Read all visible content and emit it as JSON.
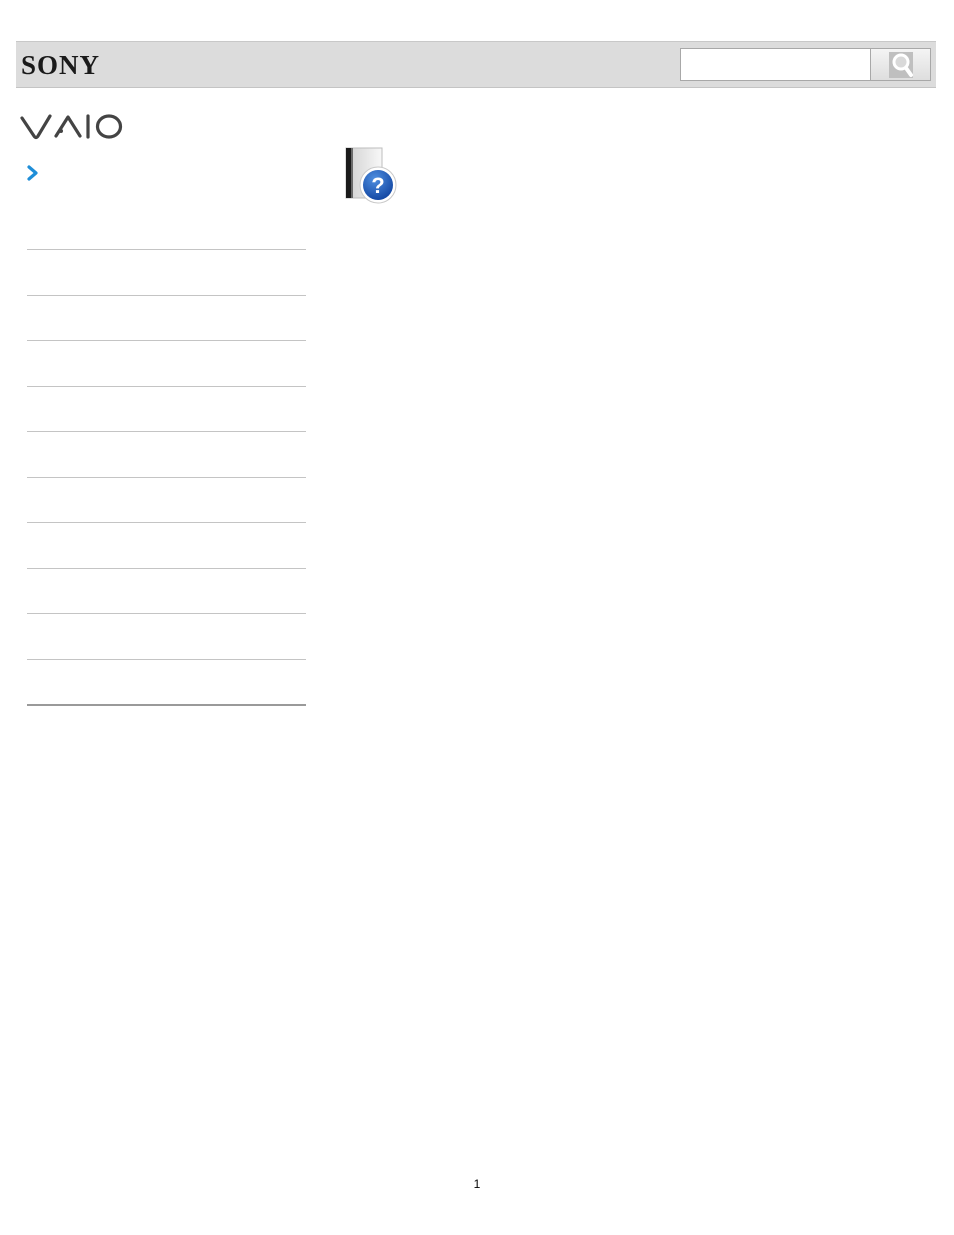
{
  "header": {
    "brand": "SONY",
    "search": {
      "value": "",
      "placeholder": ""
    },
    "search_button_icon": "magnifier-icon"
  },
  "sub_brand_logo": "vaio-logo",
  "nav": {
    "arrow_icon": "chevron-right-icon"
  },
  "sidebar": {
    "items": [
      {
        "label": ""
      },
      {
        "label": ""
      },
      {
        "label": ""
      },
      {
        "label": ""
      },
      {
        "label": ""
      },
      {
        "label": ""
      },
      {
        "label": ""
      },
      {
        "label": ""
      },
      {
        "label": ""
      },
      {
        "label": ""
      }
    ]
  },
  "content": {
    "icon": "help-book-icon"
  },
  "footer": {
    "page_number": "1"
  },
  "colors": {
    "header_bg": "#dcdcdc",
    "accent": "#1f8ed8",
    "divider": "#c4c4c4"
  }
}
